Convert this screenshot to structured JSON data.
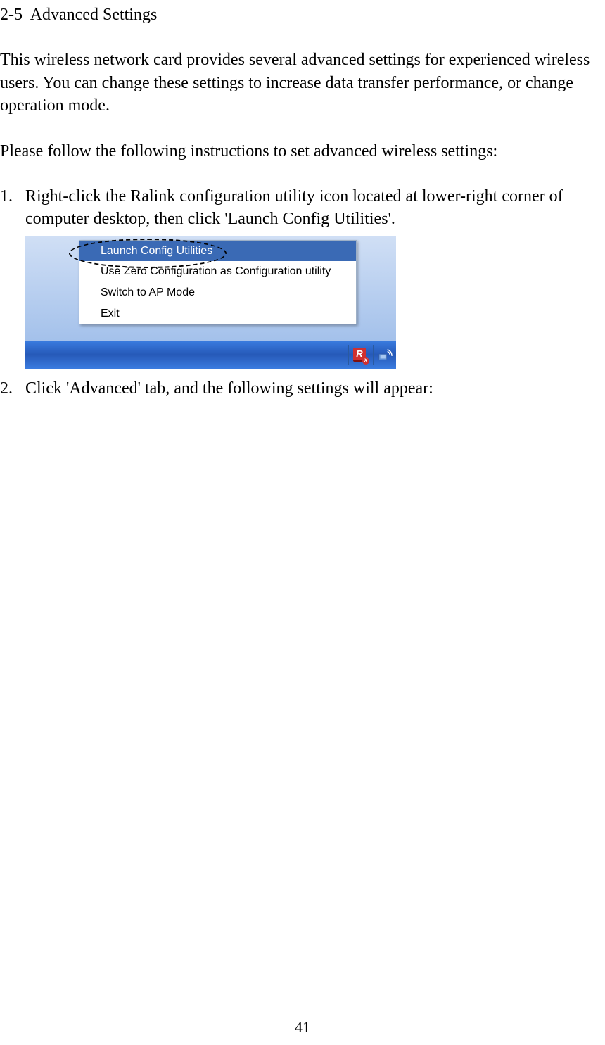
{
  "heading_number": "2-5",
  "heading_title": "Advanced Settings",
  "paragraph1": "This wireless network card provides several advanced settings for experienced wireless users. You can change these settings to increase data transfer performance, or change operation mode.",
  "paragraph2": "Please follow the following instructions to set advanced wireless settings:",
  "list": [
    {
      "number": "1.",
      "text": "Right-click the Ralink configuration utility icon located at lower-right corner of computer desktop, then click 'Launch Config Utilities'."
    },
    {
      "number": "2.",
      "text": "Click 'Advanced' tab, and the following settings will appear:"
    }
  ],
  "context_menu": {
    "items": [
      "Launch Config Utilities",
      "Use Zero Configuration as Configuration utility",
      "Switch to AP Mode",
      "Exit"
    ]
  },
  "tray_icons": {
    "ralink_letter": "R",
    "ralink_x": "x"
  },
  "page_number": "41"
}
